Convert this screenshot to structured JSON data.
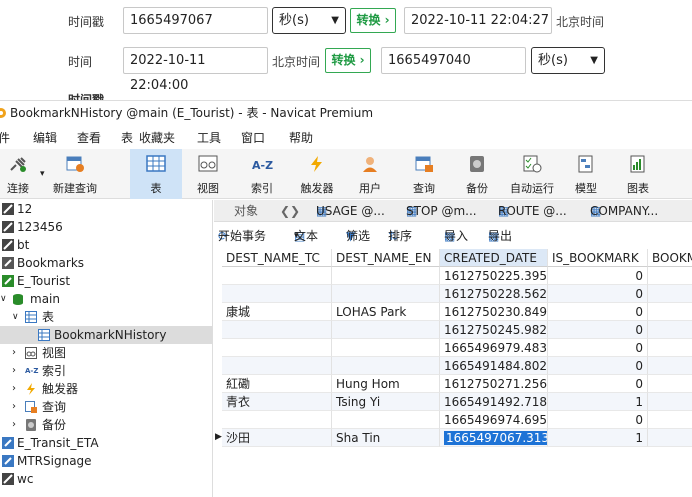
{
  "converter": {
    "row1": {
      "label": "时间戳",
      "timestamp_value": "1665497067",
      "unit_select": "秒(s)",
      "convert_label": "转换 ›",
      "result_value": "2022-10-11 22:04:27",
      "timezone": "北京时间"
    },
    "row2": {
      "label": "时间",
      "datetime_value": "2022-10-11 22:04:00",
      "timezone": "北京时间",
      "convert_label": "转换 ›",
      "result_value": "1665497040",
      "unit_select": "秒(s)"
    },
    "cut_text": "时间戳"
  },
  "window": {
    "title": "BookmarkNHistory @main (E_Tourist) - 表 - Navicat Premium",
    "menu": [
      "件",
      "编辑",
      "查看",
      "表",
      "收藏夹",
      "工具",
      "窗口",
      "帮助"
    ],
    "toolbar": [
      {
        "label": "连接",
        "icon": "plug-icon"
      },
      {
        "label": "新建查询",
        "icon": "new-query-icon"
      },
      {
        "label": "表",
        "icon": "table-icon"
      },
      {
        "label": "视图",
        "icon": "view-icon"
      },
      {
        "label": "索引",
        "icon": "index-icon"
      },
      {
        "label": "触发器",
        "icon": "trigger-icon"
      },
      {
        "label": "用户",
        "icon": "user-icon"
      },
      {
        "label": "查询",
        "icon": "query-icon"
      },
      {
        "label": "备份",
        "icon": "backup-icon"
      },
      {
        "label": "自动运行",
        "icon": "autorun-icon"
      },
      {
        "label": "模型",
        "icon": "model-icon"
      },
      {
        "label": "图表",
        "icon": "chart-icon"
      }
    ],
    "sidebar": [
      {
        "label": "12"
      },
      {
        "label": "123456"
      },
      {
        "label": "bt"
      },
      {
        "label": "Bookmarks"
      },
      {
        "label": "E_Tourist"
      },
      {
        "label": "main"
      },
      {
        "label": "表"
      },
      {
        "label": "BookmarkNHistory"
      },
      {
        "label": "视图"
      },
      {
        "label": "索引"
      },
      {
        "label": "触发器"
      },
      {
        "label": "查询"
      },
      {
        "label": "备份"
      },
      {
        "label": "E_Transit_ETA"
      },
      {
        "label": "MTRSignage"
      },
      {
        "label": "wc"
      }
    ],
    "tabs": {
      "object": "对象",
      "items": [
        "USAGE @...",
        "STOP @m...",
        "ROUTE @...",
        "COMPANY..."
      ]
    },
    "actions": {
      "begin_tx": "开始事务",
      "text": "文本",
      "filter": "筛选",
      "sort": "排序",
      "import": "导入",
      "export": "导出"
    },
    "grid": {
      "columns": [
        "DEST_NAME_TC",
        "DEST_NAME_EN",
        "CREATED_DATE",
        "IS_BOOKMARK",
        "BOOKM"
      ],
      "rows": [
        {
          "tc": "",
          "en": "",
          "date": "1612750225.39501",
          "bm": "0"
        },
        {
          "tc": "",
          "en": "",
          "date": "1612750228.56242",
          "bm": "0"
        },
        {
          "tc": "康城",
          "en": "LOHAS Park",
          "date": "1612750230.84971",
          "bm": "0"
        },
        {
          "tc": "",
          "en": "",
          "date": "1612750245.98271",
          "bm": "0"
        },
        {
          "tc": "",
          "en": "",
          "date": "1665496979.48307",
          "bm": "0"
        },
        {
          "tc": "",
          "en": "",
          "date": "1665491484.80293",
          "bm": "0"
        },
        {
          "tc": "紅磡",
          "en": "Hung Hom",
          "date": "1612750271.25668",
          "bm": "0"
        },
        {
          "tc": "青衣",
          "en": "Tsing Yi",
          "date": "1665491492.71854",
          "bm": "1"
        },
        {
          "tc": "",
          "en": "",
          "date": "1665496974.6952",
          "bm": "0"
        },
        {
          "tc": "沙田",
          "en": "Sha Tin",
          "date": "1665497067.31387",
          "bm": "1"
        }
      ]
    }
  }
}
